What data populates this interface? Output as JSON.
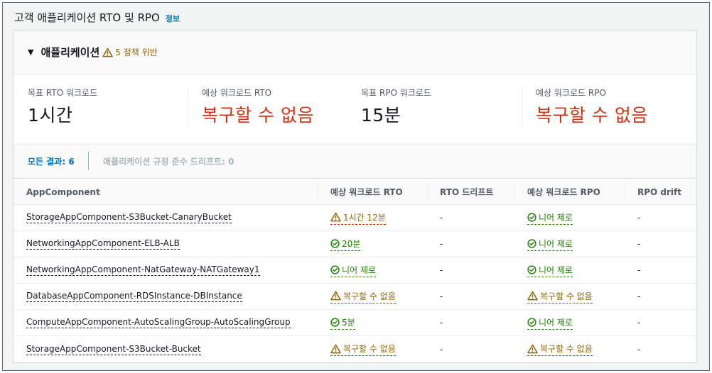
{
  "section": {
    "title": "고객 애플리케이션 RTO 및 RPO",
    "info": "정보"
  },
  "expander": {
    "title": "애플리케이션",
    "violation": "5 정책 위반"
  },
  "metrics": [
    {
      "label": "목표 RTO 워크로드",
      "value": "1시간",
      "bad": false
    },
    {
      "label": "예상 워크로드 RTO",
      "value": "복구할 수 없음",
      "bad": true
    },
    {
      "label": "목표 RPO 워크로드",
      "value": "15분",
      "bad": false
    },
    {
      "label": "예상 워크로드 RPO",
      "value": "복구할 수 없음",
      "bad": true
    }
  ],
  "tabs": {
    "active": "모든 결과: 6",
    "inactive": "애플리케이션 규정 준수 드리프트: 0"
  },
  "table": {
    "headers": [
      "AppComponent",
      "예상 워크로드 RTO",
      "RTO 드리프트",
      "예상 워크로드 RPO",
      "RPO drift"
    ],
    "rows": [
      {
        "component": "StorageAppComponent-S3Bucket-CanaryBucket",
        "rto": "1시간 12분",
        "rto_status": "warning",
        "rto_drift": "-",
        "rpo": "니어 제로",
        "rpo_status": "ok",
        "rpo_drift": "-"
      },
      {
        "component": "NetworkingAppComponent-ELB-ALB",
        "rto": "20분",
        "rto_status": "ok",
        "rto_drift": "-",
        "rpo": "니어 제로",
        "rpo_status": "ok",
        "rpo_drift": "-"
      },
      {
        "component": "NetworkingAppComponent-NatGateway-NATGateway1",
        "rto": "니어 제로",
        "rto_status": "ok",
        "rto_drift": "-",
        "rpo": "니어 제로",
        "rpo_status": "ok",
        "rpo_drift": "-"
      },
      {
        "component": "DatabaseAppComponent-RDSInstance-DBInstance",
        "rto": "복구할 수 없음",
        "rto_status": "warning",
        "rto_drift": "-",
        "rpo": "복구할 수 없음",
        "rpo_status": "warning",
        "rpo_drift": "-"
      },
      {
        "component": "ComputeAppComponent-AutoScalingGroup-AutoScalingGroup",
        "rto": "5분",
        "rto_status": "ok",
        "rto_drift": "-",
        "rpo": "니어 제로",
        "rpo_status": "ok",
        "rpo_drift": "-"
      },
      {
        "component": "StorageAppComponent-S3Bucket-Bucket",
        "rto": "복구할 수 없음",
        "rto_status": "warning",
        "rto_drift": "-",
        "rpo": "복구할 수 없음",
        "rpo_status": "warning",
        "rpo_drift": "-"
      }
    ]
  },
  "colors": {
    "warning": "#8d6605",
    "ok": "#1d8102",
    "error": "#d13212",
    "link": "#0073bb"
  }
}
